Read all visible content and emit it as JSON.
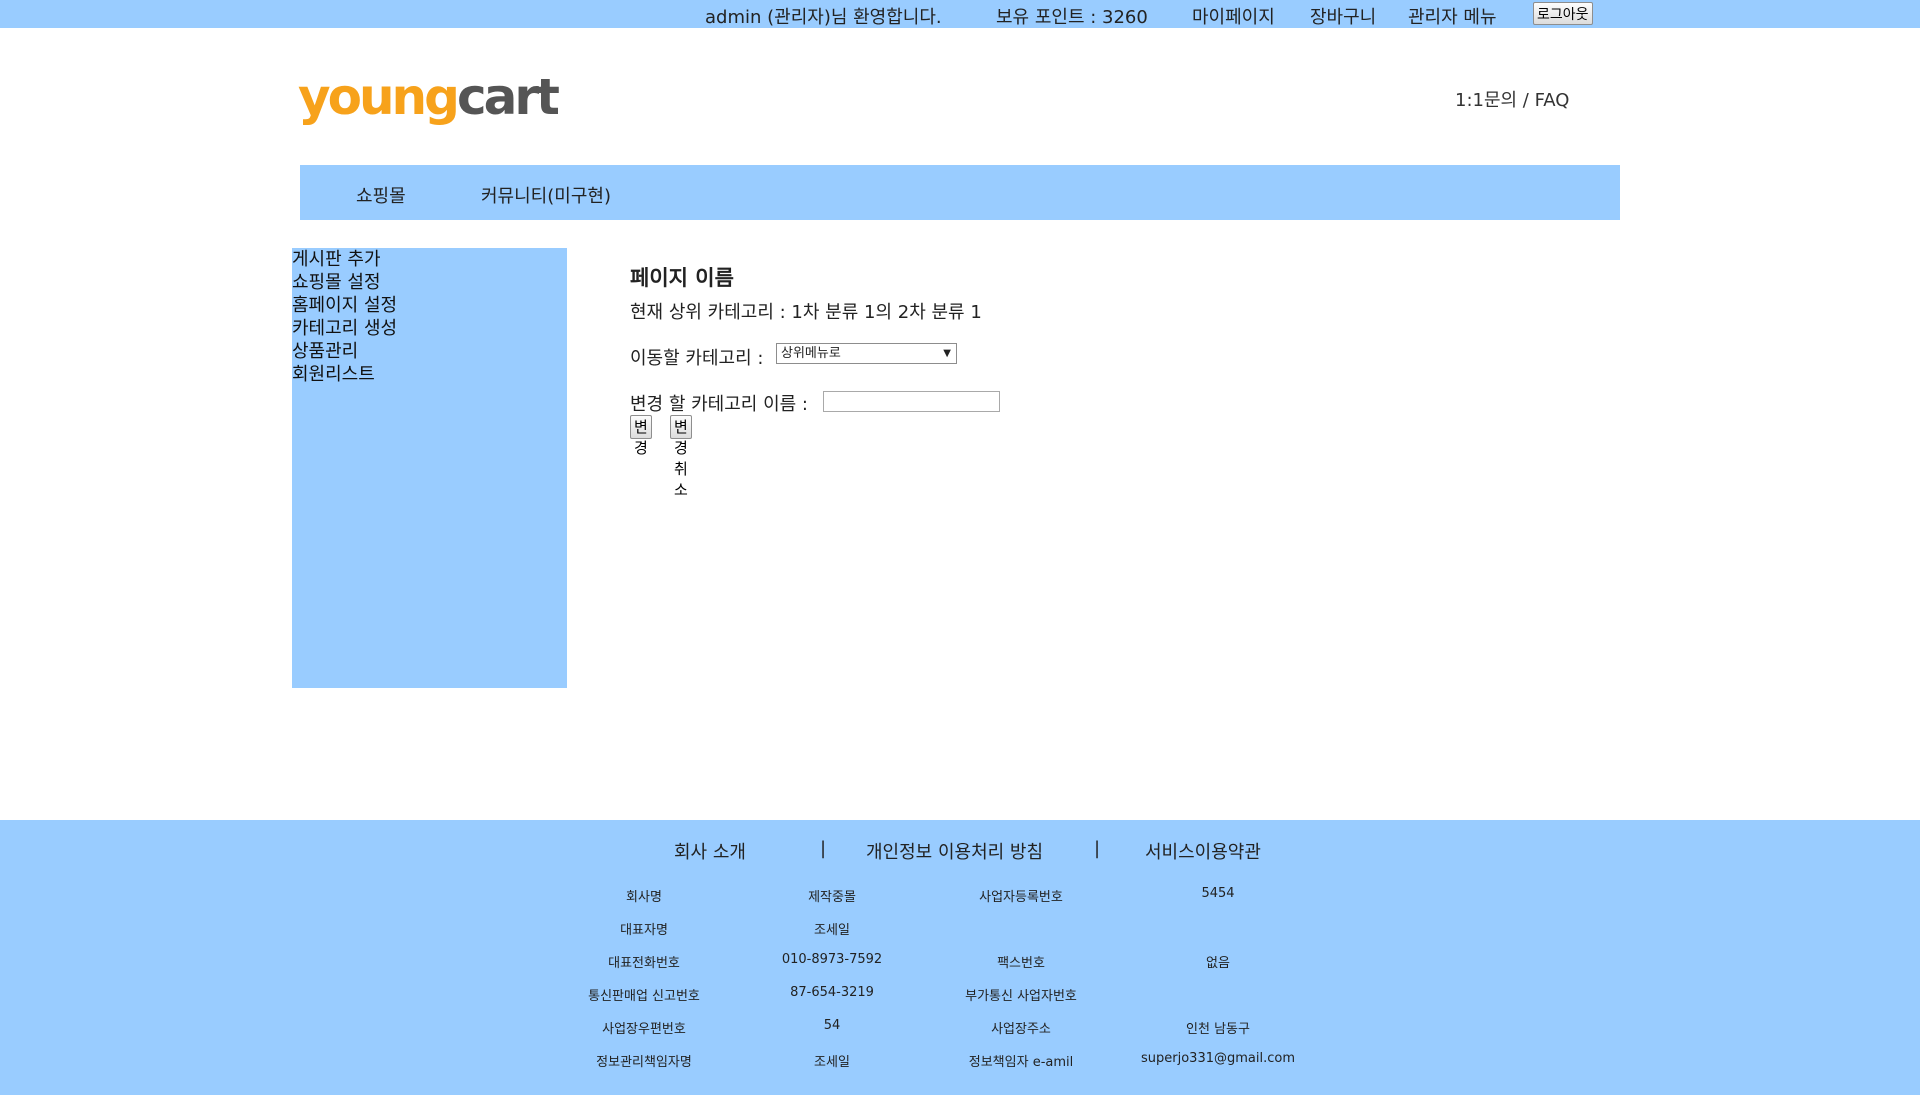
{
  "topbar": {
    "welcome": "admin (관리자)님 환영합니다.",
    "points": "보유 포인트 : 3260",
    "mypage": "마이페이지",
    "cart": "장바구니",
    "admin_menu": "관리자 메뉴",
    "logout": "로그아웃"
  },
  "header": {
    "logo_young": "young",
    "logo_cart": "cart",
    "qna_faq": "1:1문의 / FAQ"
  },
  "nav": {
    "items": [
      "쇼핑몰",
      "커뮤니티(미구현)"
    ]
  },
  "sidebar": {
    "items": [
      "게시판 추가",
      "쇼핑몰 설정",
      "홈페이지 설정",
      "카테고리 생성",
      "상품관리",
      "회원리스트"
    ]
  },
  "main": {
    "title": "페이지 이름",
    "current_category": "현재 상위 카테고리 : 1차 분류 1의 2차 분류 1",
    "move_label": "이동할 카테고리 :",
    "move_selected": "상위메뉴로",
    "rename_label": "변경 할 카테고리 이름 :",
    "rename_value": "",
    "change_button": "변경",
    "cancel_button": "변경 취소"
  },
  "footer": {
    "links": [
      "회사 소개",
      "개인정보 이용처리 방침",
      "서비스이용약관"
    ],
    "separator": "|",
    "rows": [
      [
        "회사명",
        "제작중몰",
        "사업자등록번호",
        "5454"
      ],
      [
        "대표자명",
        "조세일",
        "",
        ""
      ],
      [
        "대표전화번호",
        "010-8973-7592",
        "팩스번호",
        "없음"
      ],
      [
        "통신판매업 신고번호",
        "87-654-3219",
        "부가통신 사업자번호",
        ""
      ],
      [
        "사업장우편번호",
        "54",
        "사업장주소",
        "인천 남동구"
      ],
      [
        "정보관리책임자명",
        "조세일",
        "정보책임자 e-amil",
        "superjo331@gmail.com"
      ]
    ]
  },
  "colors": {
    "accent": "#99ccff",
    "logo_orange": "#f7a21b",
    "logo_gray": "#555555"
  }
}
